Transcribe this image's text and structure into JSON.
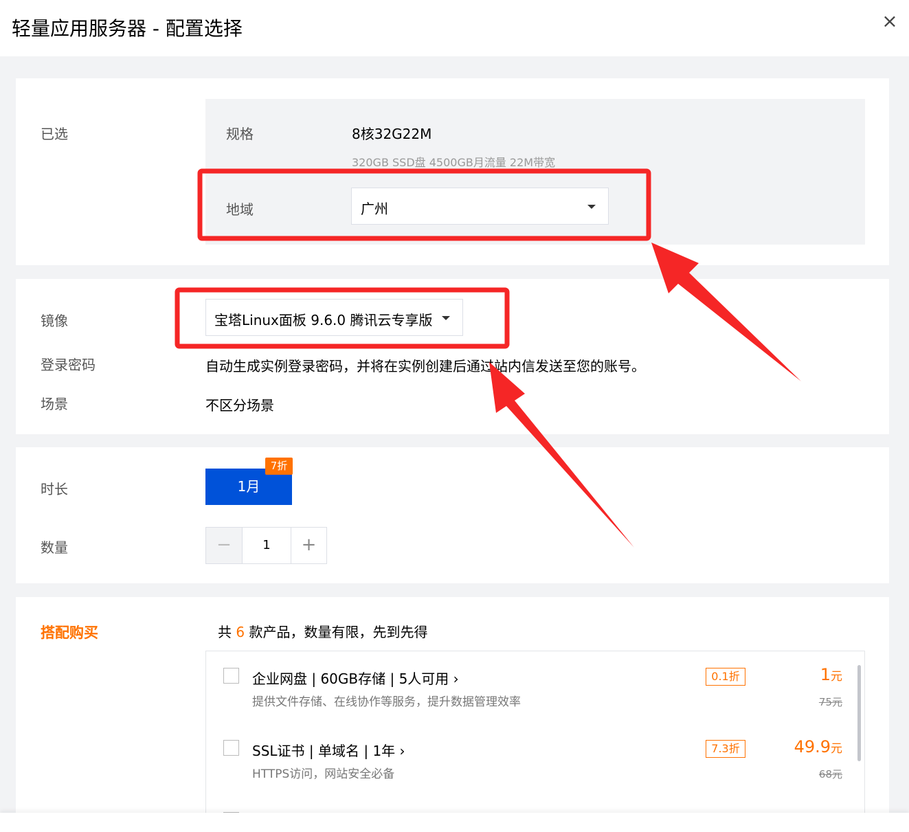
{
  "dialog": {
    "title": "轻量应用服务器 - 配置选择",
    "close_label": "×"
  },
  "selected": {
    "label": "已选",
    "spec_key": "规格",
    "spec_value": "8核32G22M",
    "spec_detail": "320GB SSD盘 4500GB月流量 22M带宽",
    "region_key": "地域",
    "region_value": "广州"
  },
  "image_section": {
    "image_label": "镜像",
    "image_value": "宝塔Linux面板 9.6.0 腾讯云专享版",
    "password_label": "登录密码",
    "password_text": "自动生成实例登录密码，并将在实例创建后通过站内信发送至您的账号。",
    "scene_label": "场景",
    "scene_value": "不区分场景"
  },
  "duration": {
    "label": "时长",
    "option": "1月",
    "discount": "7折",
    "quantity_label": "数量",
    "minus": "−",
    "quantity": "1",
    "plus": "+"
  },
  "combo": {
    "label": "搭配购买",
    "head_prefix": "共",
    "head_count": "6",
    "head_suffix": "款产品，数量有限，先到先得",
    "products": [
      {
        "name": "企业网盘 | 60GB存储 | 5人可用 ›",
        "desc": "提供文件存储、在线协作等服务，提升数据管理效率",
        "discount": "0.1折",
        "price": "1",
        "unit": "元",
        "original": "75元"
      },
      {
        "name": "SSL证书 | 单域名 | 1年 ›",
        "desc": "HTTPS访问，网站安全必备",
        "discount": "7.3折",
        "price": "49.9",
        "unit": "元",
        "original": "68元"
      }
    ]
  },
  "annotation_color": "#f52626",
  "accent_color": "#0052d9",
  "promo_color": "#ff7200"
}
